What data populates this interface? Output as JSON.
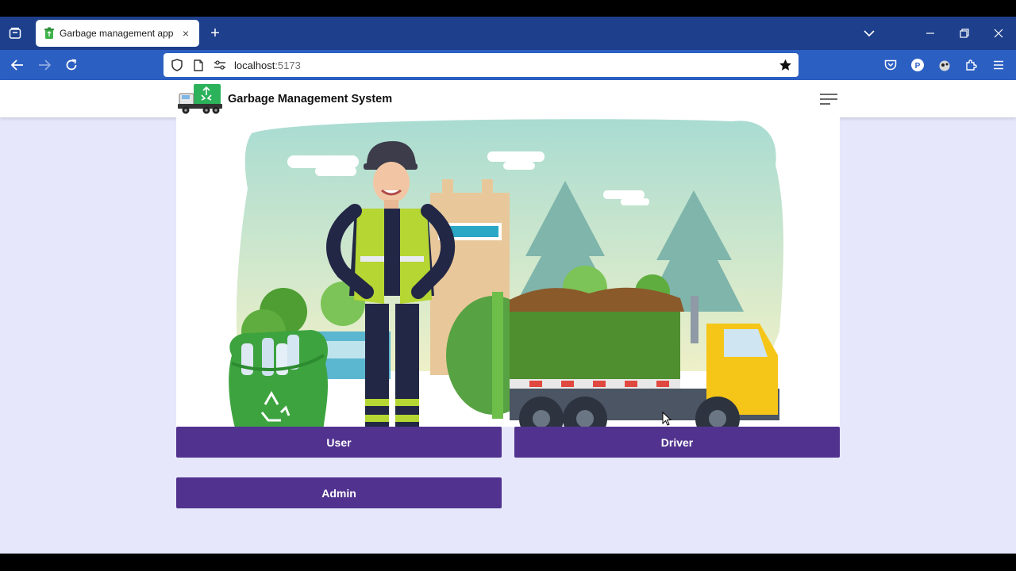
{
  "browser": {
    "tab_title": "Garbage management app",
    "url_host": "localhost",
    "url_port": ":5173"
  },
  "app": {
    "brand_title": "Garbage Management System"
  },
  "buttons": {
    "user": "User",
    "driver": "Driver",
    "admin": "Admin"
  },
  "icons": {
    "tab_close": "×",
    "new_tab": "+"
  },
  "colors": {
    "tab_strip": "#1d3f8c",
    "nav_bar": "#2c5fc2",
    "button": "#51338f",
    "page_bg": "#e6e7fb"
  }
}
